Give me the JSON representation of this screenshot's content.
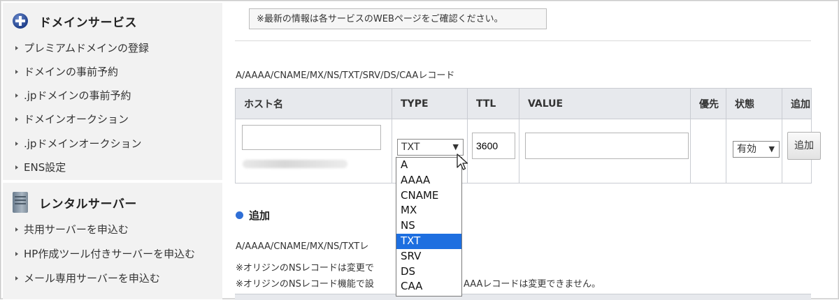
{
  "notice": "※最新の情報は各サービスのWEBページをご確認ください。",
  "sidebar": {
    "sections": [
      {
        "title": "ドメインサービス",
        "icon": "plus-circle-icon",
        "items": [
          "プレミアムドメインの登録",
          "ドメインの事前予約",
          ".jpドメインの事前予約",
          "ドメインオークション",
          ".jpドメインオークション",
          "ENS設定"
        ]
      },
      {
        "title": "レンタルサーバー",
        "icon": "server-icon",
        "items": [
          "共用サーバーを申込む",
          "HP作成ツール付きサーバーを申込む",
          "メール専用サーバーを申込む"
        ]
      }
    ]
  },
  "records": {
    "label": "A/AAAA/CNAME/MX/NS/TXT/SRV/DS/CAAレコード",
    "columns": [
      "ホスト名",
      "TYPE",
      "TTL",
      "VALUE",
      "優先",
      "状態",
      "追加"
    ],
    "row": {
      "host_value": "",
      "type_value": "TXT",
      "ttl_value": "3600",
      "value_value": "",
      "priority_value": "",
      "status_value": "有効",
      "add_button": "追加"
    }
  },
  "type_dropdown": {
    "options": [
      "A",
      "AAAA",
      "CNAME",
      "MX",
      "NS",
      "TXT",
      "SRV",
      "DS",
      "CAA"
    ],
    "selected": "TXT"
  },
  "add_section": {
    "title": "追加",
    "label": "A/AAAA/CNAME/MX/NS/TXTレ",
    "notes": [
      "※オリジンのNSレコードは変更で",
      "※オリジンのNSレコード機能で設",
      "AAAレコードは変更できません。"
    ]
  },
  "colors": {
    "accent": "#2f6fd6",
    "selected_option": "#1e6fe0",
    "header_bg": "#e7e9ed"
  }
}
